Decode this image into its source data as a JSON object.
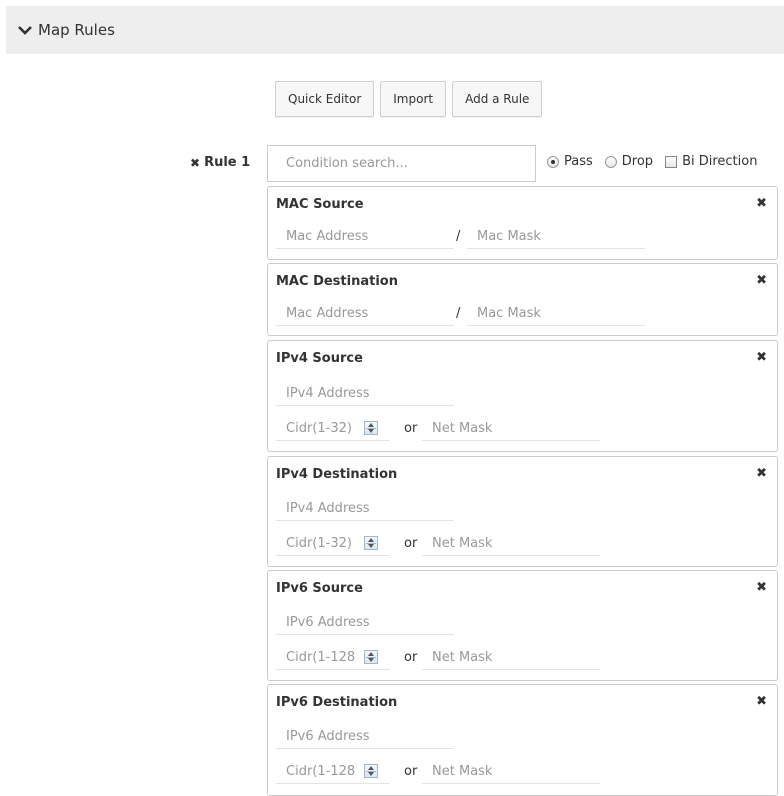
{
  "header": {
    "title": "Map Rules",
    "icon": "chevron-down-icon"
  },
  "toolbar": {
    "quick_editor": "Quick Editor",
    "import": "Import",
    "add_rule": "Add a Rule"
  },
  "rule": {
    "label": "Rule 1",
    "search_placeholder": "Condition search...",
    "options": {
      "pass": "Pass",
      "drop": "Drop",
      "bidirection": "Bi Direction",
      "selected": "Pass"
    }
  },
  "cards": {
    "mac_source": {
      "title": "MAC Source",
      "address": "Mac Address",
      "mask": "Mac Mask",
      "slash": "/"
    },
    "mac_destination": {
      "title": "MAC Destination",
      "address": "Mac Address",
      "mask": "Mac Mask",
      "slash": "/"
    },
    "ipv4_source": {
      "title": "IPv4 Source",
      "address": "IPv4 Address",
      "cidr": "Cidr(1-32)",
      "or": "or",
      "netmask": "Net Mask"
    },
    "ipv4_destination": {
      "title": "IPv4 Destination",
      "address": "IPv4 Address",
      "cidr": "Cidr(1-32)",
      "or": "or",
      "netmask": "Net Mask"
    },
    "ipv6_source": {
      "title": "IPv6 Source",
      "address": "IPv6 Address",
      "cidr": "Cidr(1-128",
      "or": "or",
      "netmask": "Net Mask"
    },
    "ipv6_destination": {
      "title": "IPv6 Destination",
      "address": "IPv6 Address",
      "cidr": "Cidr(1-128",
      "or": "or",
      "netmask": "Net Mask"
    }
  },
  "colors": {
    "header_bg": "#eeeeee",
    "border": "#cccccc",
    "placeholder": "#999999"
  }
}
